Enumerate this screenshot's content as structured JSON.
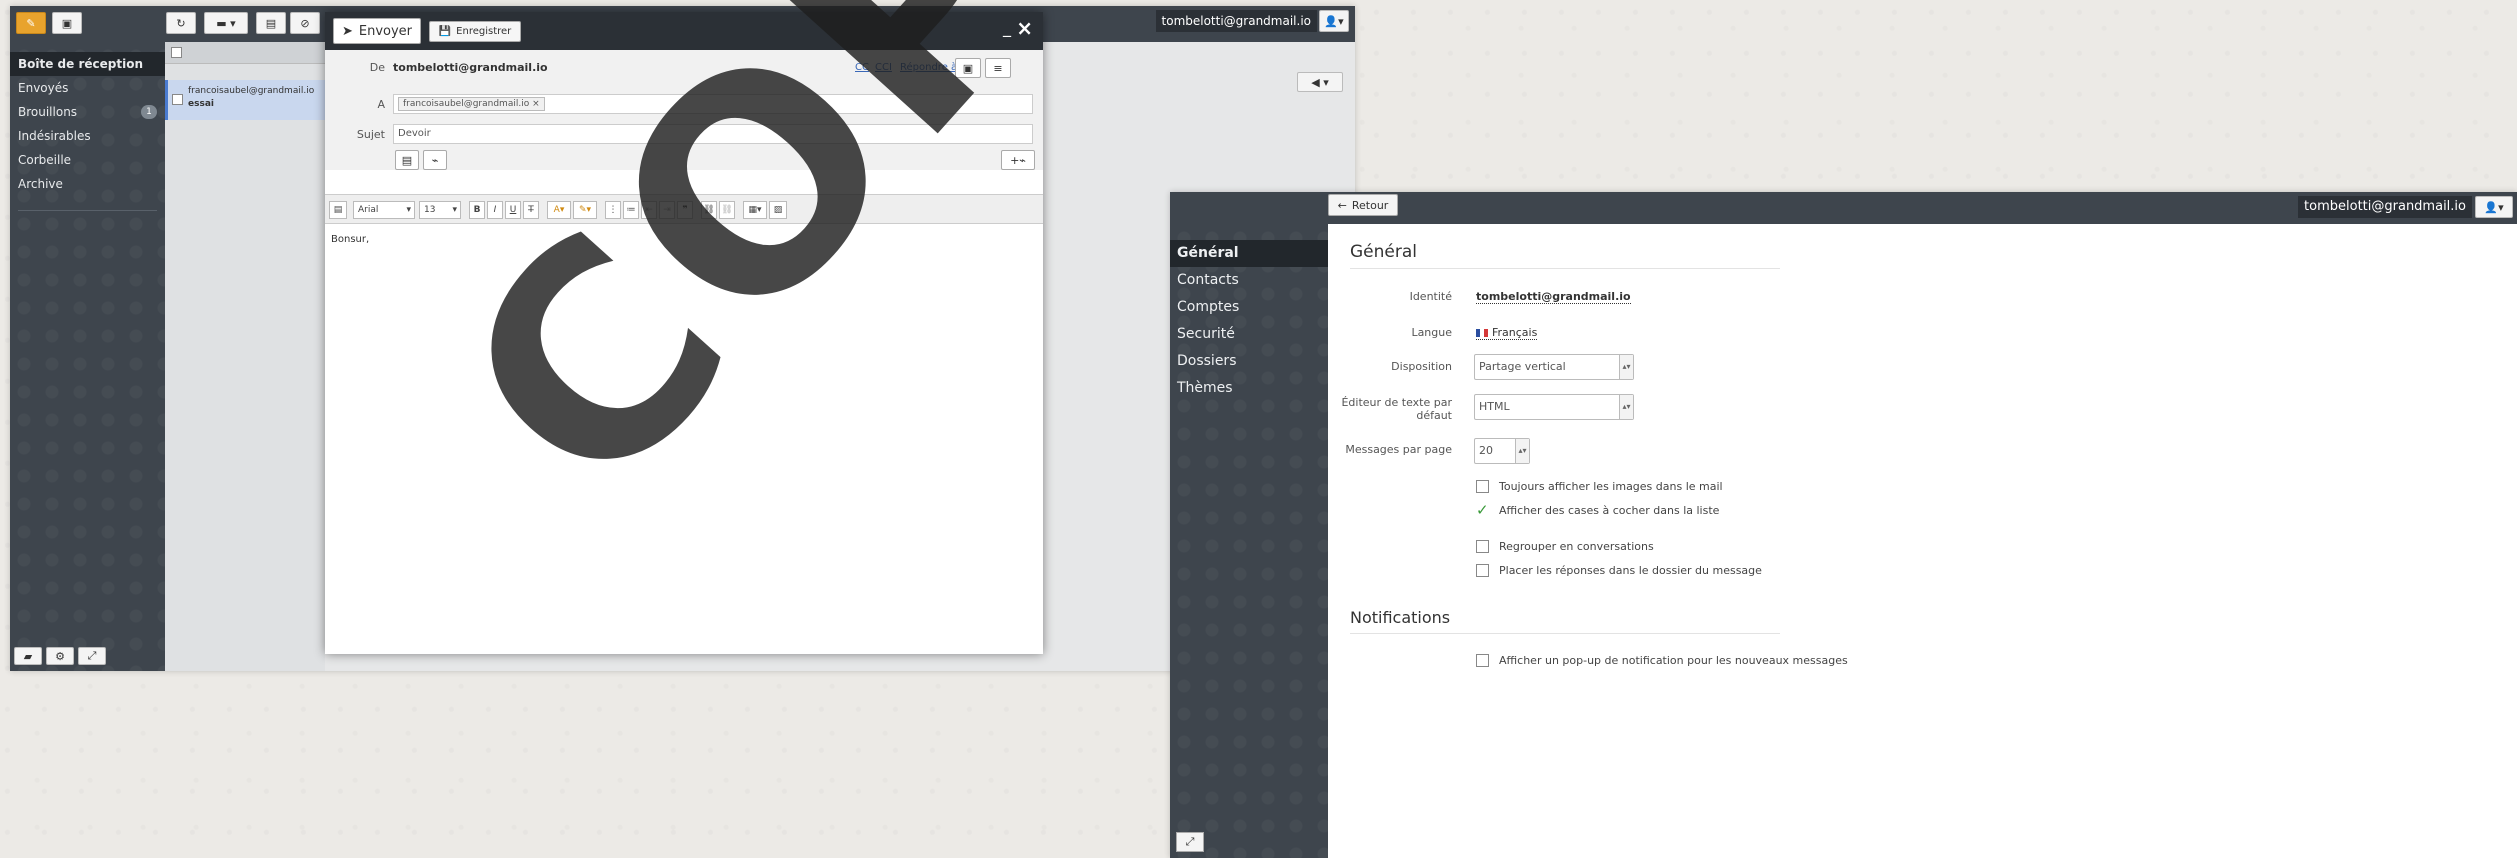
{
  "mail": {
    "folders": [
      {
        "label": "Boîte de réception"
      },
      {
        "label": "Envoyés"
      },
      {
        "label": "Brouillons",
        "badge": "1"
      },
      {
        "label": "Indésirables"
      },
      {
        "label": "Corbeille"
      },
      {
        "label": "Archive"
      }
    ],
    "user": "tombelotti@grandmail.io",
    "message": {
      "from": "francoisaubel@grandmail.io",
      "subject": "essai"
    }
  },
  "compose": {
    "send_label": "Envoyer",
    "save_label": "Enregistrer",
    "from_label": "De",
    "from_value": "tombelotti@grandmail.io",
    "cc": "CC",
    "cci": "CCI",
    "reply_to": "Répondre à",
    "to_label": "A",
    "to_token": "francoisaubel@grandmail.io",
    "subject_label": "Sujet",
    "subject_value": "Devoir",
    "font_name": "Arial",
    "font_size": "13",
    "body": "Bonsur,"
  },
  "settings": {
    "back_label": "Retour",
    "user": "tombelotti@grandmail.io",
    "nav": [
      "Général",
      "Contacts",
      "Comptes",
      "Securité",
      "Dossiers",
      "Thèmes"
    ],
    "general_title": "Général",
    "identity_label": "Identité",
    "identity_value": "tombelotti@grandmail.io",
    "language_label": "Langue",
    "language_value": "Français",
    "layout_label": "Disposition",
    "layout_value": "Partage vertical",
    "editor_label": "Éditeur de texte par défaut",
    "editor_value": "HTML",
    "per_page_label": "Messages par page",
    "per_page_value": "20",
    "options": [
      "Toujours afficher les images dans le mail",
      "Afficher des cases à cocher dans la liste",
      "Regrouper en conversations",
      "Placer les réponses dans le dossier du message"
    ],
    "notifications_title": "Notifications",
    "notification_option": "Afficher un pop-up de notification pour les nouveaux messages"
  },
  "watermark": "COPYRIGHT"
}
